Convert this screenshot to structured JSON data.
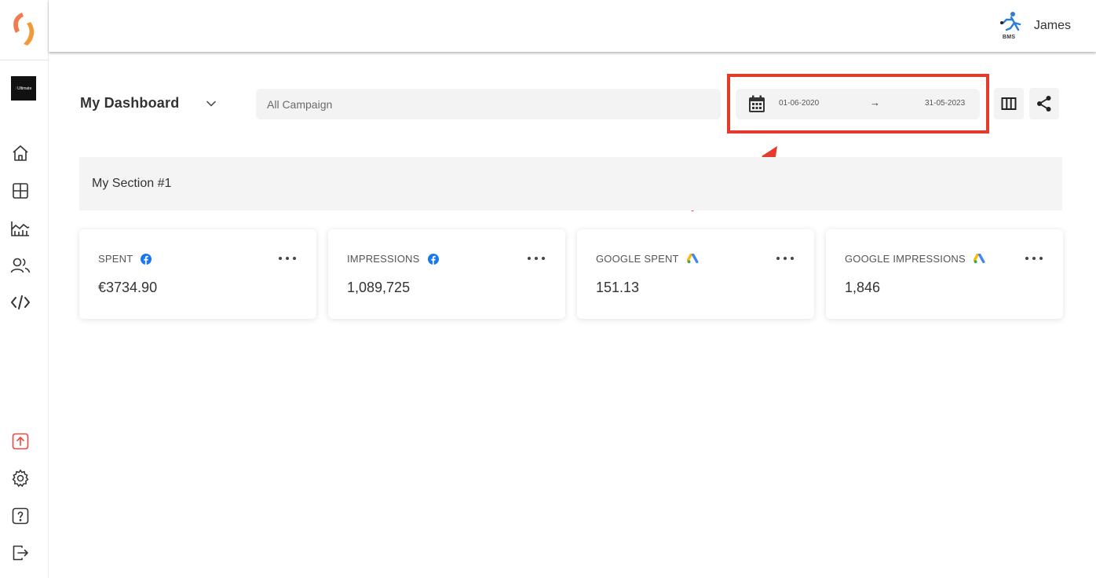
{
  "header": {
    "user_name": "James",
    "user_logo_text": "BMS"
  },
  "sidebar": {
    "brand_chip": "Ultimate",
    "items": [
      {
        "icon": "home-icon"
      },
      {
        "icon": "dashboard-grid-icon"
      },
      {
        "icon": "area-chart-icon"
      },
      {
        "icon": "users-icon"
      },
      {
        "icon": "code-icon"
      }
    ],
    "bottom_items": [
      {
        "icon": "upload-icon"
      },
      {
        "icon": "gear-icon"
      },
      {
        "icon": "help-icon"
      },
      {
        "icon": "logout-icon"
      }
    ]
  },
  "toolbar": {
    "dashboard_title": "My Dashboard",
    "campaign_placeholder": "All Campaign",
    "date_start": "01-06-2020",
    "date_arrow": "→",
    "date_end": "31-05-2023"
  },
  "section": {
    "title": "My Section #1"
  },
  "cards": [
    {
      "label": "SPENT",
      "source_icon": "facebook-icon",
      "value": "€3734.90"
    },
    {
      "label": "IMPRESSIONS",
      "source_icon": "facebook-icon",
      "value": "1,089,725"
    },
    {
      "label": "GOOGLE SPENT",
      "source_icon": "google-ads-icon",
      "value": "151.13"
    },
    {
      "label": "GOOGLE IMPRESSIONS",
      "source_icon": "google-ads-icon",
      "value": "1,846"
    }
  ],
  "colors": {
    "accent": "#e8493f",
    "highlight": "#e53a2c",
    "facebook": "#1877f2",
    "panel": "#f3f3f3"
  }
}
